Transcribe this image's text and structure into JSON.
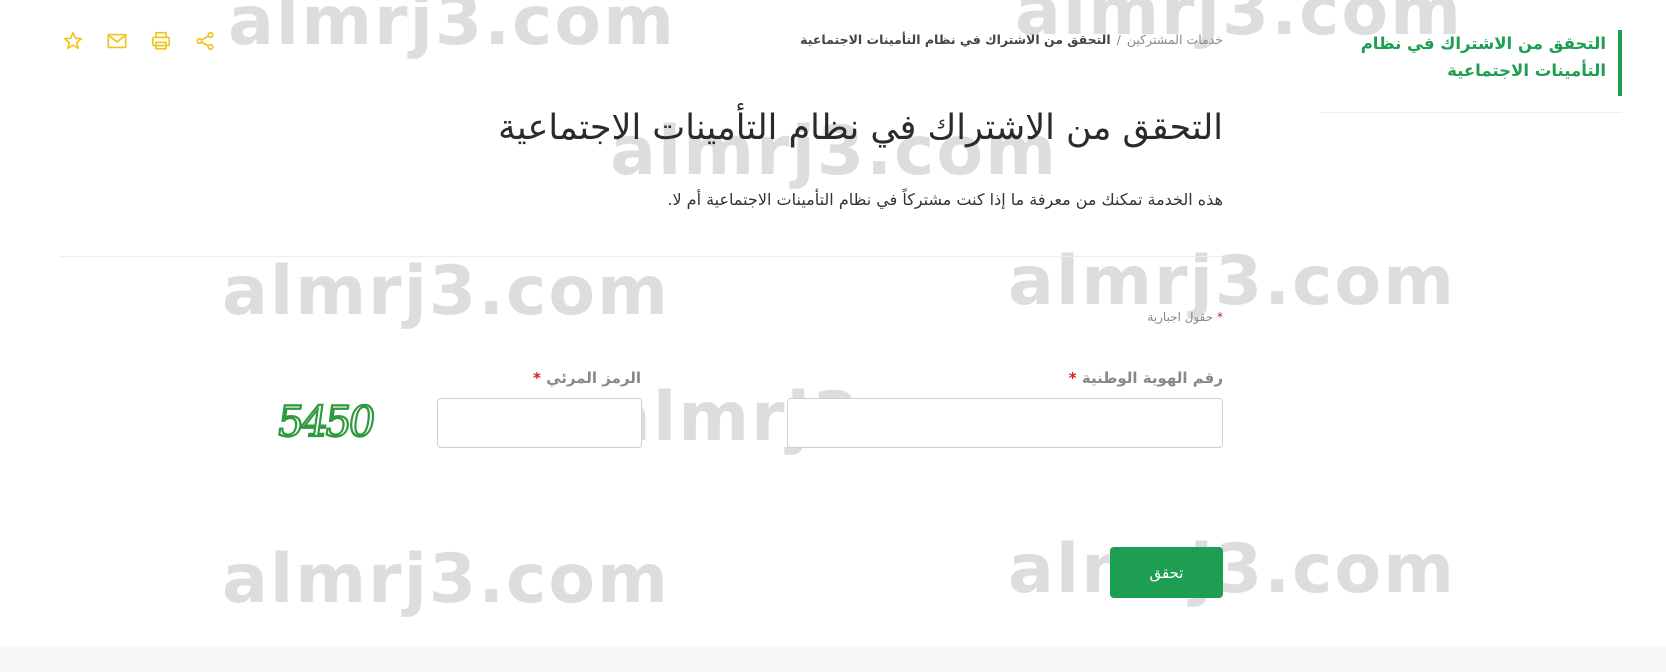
{
  "sidebar": {
    "items": [
      {
        "label_line1": "التحقق من الاشتراك في نظام",
        "label_line2": "التأمينات الاجتماعية"
      }
    ]
  },
  "breadcrumb": {
    "parent": "خدمات المشتركين",
    "separator": "/",
    "current": "التحقق من الاشتراك في نظام التأمينات الاجتماعية"
  },
  "toolbar": {
    "icons": [
      "star-icon",
      "mail-icon",
      "print-icon",
      "share-icon"
    ],
    "icon_color": "#f0c419"
  },
  "page": {
    "title": "التحقق من الاشتراك في نظام التأمينات الاجتماعية",
    "description": "هذه الخدمة تمكنك من معرفة ما إذا كنت مشتركاً في نظام التأمينات الاجتماعية أم لا."
  },
  "form": {
    "required_marker": "*",
    "required_note": "حقول اجبارية",
    "national_id": {
      "label": "رقم الهوية الوطنية",
      "value": ""
    },
    "captcha": {
      "label": "الرمز المرئي",
      "value": "",
      "image_text": "5450"
    },
    "submit_label": "تحقق"
  },
  "watermark": {
    "text": "almrj3.com"
  },
  "colors": {
    "accent": "#1e9e52",
    "required": "#d02020",
    "toolbar_icon": "#f0c419"
  }
}
